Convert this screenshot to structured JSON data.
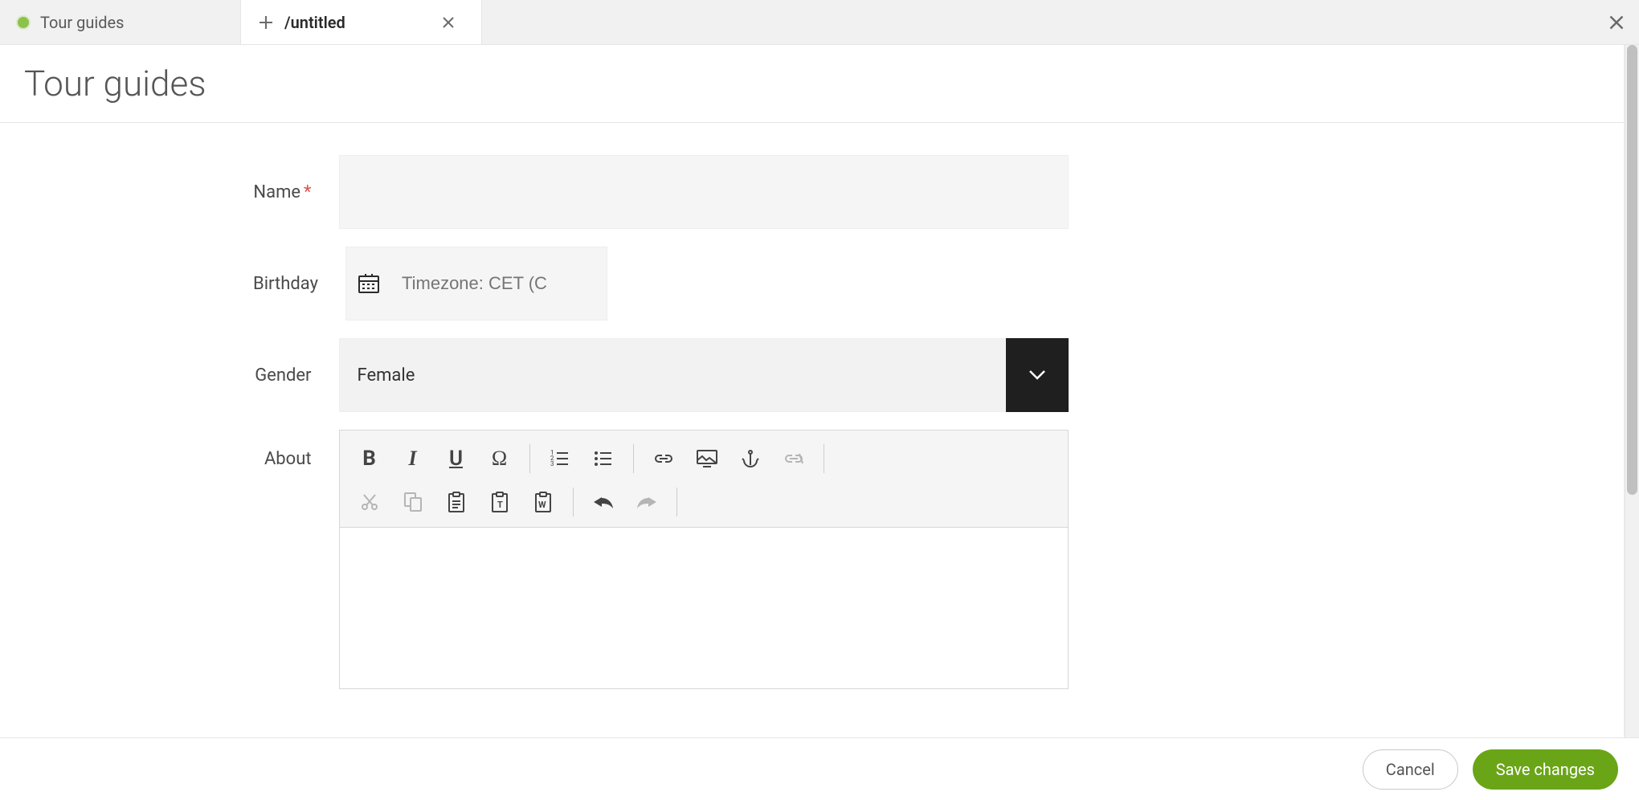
{
  "tabs": [
    {
      "label": "Tour guides",
      "active": false,
      "icon": "status-dot"
    },
    {
      "label": "/untitled",
      "active": true,
      "icon": "plus"
    }
  ],
  "page": {
    "title": "Tour guides"
  },
  "form": {
    "name": {
      "label": "Name",
      "required": true,
      "value": ""
    },
    "birthday": {
      "label": "Birthday",
      "placeholder": "Timezone: CET (C",
      "value": ""
    },
    "gender": {
      "label": "Gender",
      "value": "Female"
    },
    "about": {
      "label": "About"
    }
  },
  "rte_icons": {
    "bold": "bold-icon",
    "italic": "italic-icon",
    "underline": "underline-icon",
    "special": "special-char-icon",
    "ol": "ordered-list-icon",
    "ul": "unordered-list-icon",
    "link": "link-icon",
    "image": "image-icon",
    "anchor": "anchor-icon",
    "unlink": "unlink-icon",
    "cut": "cut-icon",
    "copy": "copy-icon",
    "paste": "paste-icon",
    "paste_text": "paste-text-icon",
    "paste_word": "paste-word-icon",
    "undo": "undo-icon",
    "redo": "redo-icon"
  },
  "footer": {
    "cancel": "Cancel",
    "save": "Save changes"
  },
  "colors": {
    "accent": "#6aa518",
    "danger": "#d9534f",
    "muted_bg": "#f5f5f5"
  }
}
